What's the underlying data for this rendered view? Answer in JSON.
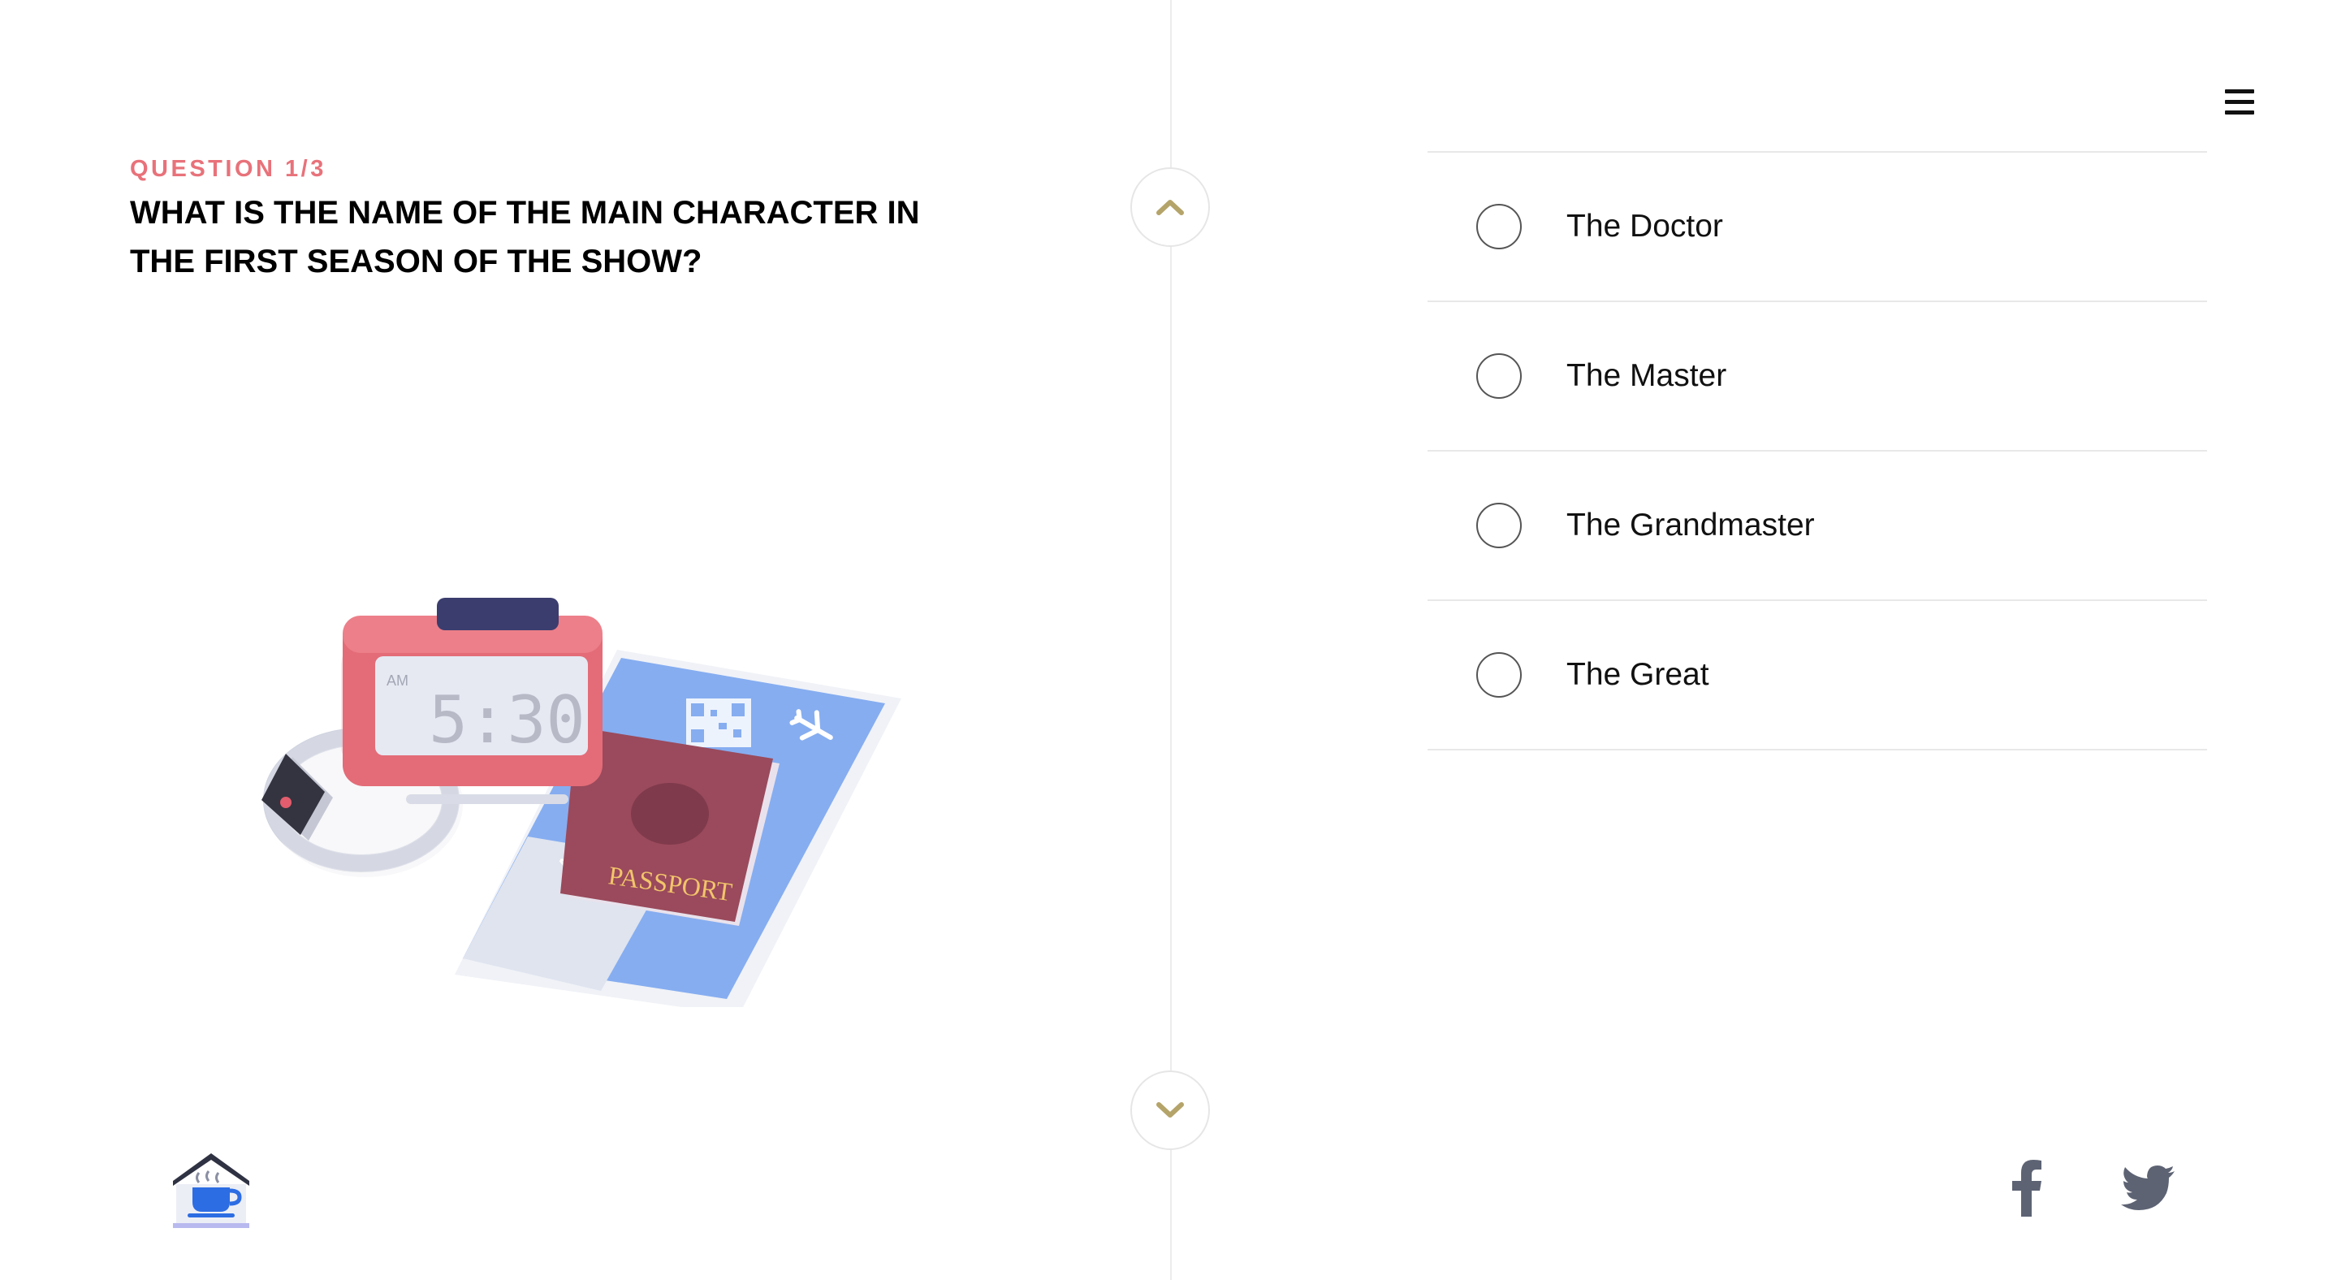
{
  "question": {
    "counter": "QUESTION 1/3",
    "title": "WHAT IS THE NAME OF THE MAIN CHARACTER IN THE FIRST SEASON OF THE SHOW?"
  },
  "answers": [
    {
      "label": "The Doctor"
    },
    {
      "label": "The Master"
    },
    {
      "label": "The Grandmaster"
    },
    {
      "label": "The Great"
    }
  ],
  "illustration": {
    "clock_period": "AM",
    "clock_time": "5:30",
    "ticket_text": "AIR",
    "passport_text": "PASSPORT"
  },
  "icons": {
    "menu": "hamburger-menu-icon",
    "nav_up": "chevron-up-icon",
    "nav_down": "chevron-down-icon",
    "home": "coffee-house-logo",
    "facebook": "facebook-icon",
    "twitter": "twitter-icon"
  },
  "colors": {
    "accent": "#e8727a",
    "chevron": "#b5a46a",
    "social": "#5d6373"
  }
}
